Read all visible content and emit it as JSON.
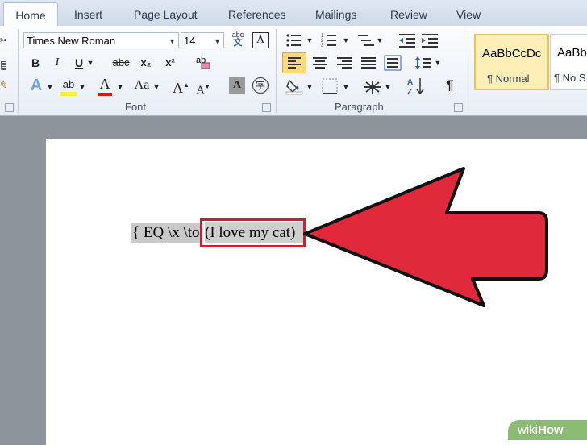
{
  "tabs": [
    "Home",
    "Insert",
    "Page Layout",
    "References",
    "Mailings",
    "Review",
    "View"
  ],
  "font": {
    "name": "Times New Roman",
    "size": "14",
    "group_label": "Font",
    "grow_label": "A",
    "shrink_label": "A",
    "change_case_label": "Aa",
    "bold": "B",
    "italic": "I",
    "underline": "U",
    "strike": "abc",
    "subscript": "x₂",
    "superscript": "x²",
    "clear_format": "A",
    "text_effects": "A",
    "highlight": "ab",
    "font_color": "A",
    "char_shading": "A",
    "enclose": "字"
  },
  "paragraph": {
    "group_label": "Paragraph",
    "show_marks": "¶"
  },
  "styles": [
    {
      "sample": "AaBbCcDc",
      "name": "¶ Normal"
    },
    {
      "sample": "AaBb",
      "name": "¶ No S"
    }
  ],
  "document": {
    "field_code": "{ EQ  \\x \\to",
    "highlighted": "(I love my cat)"
  },
  "watermark": {
    "prefix": "wiki",
    "brand": "How"
  },
  "colors": {
    "arrow": "#e0293a",
    "highlight_border": "#c9202f",
    "highlight_pen": "#f3f03a",
    "font_red": "#d41a1a"
  }
}
